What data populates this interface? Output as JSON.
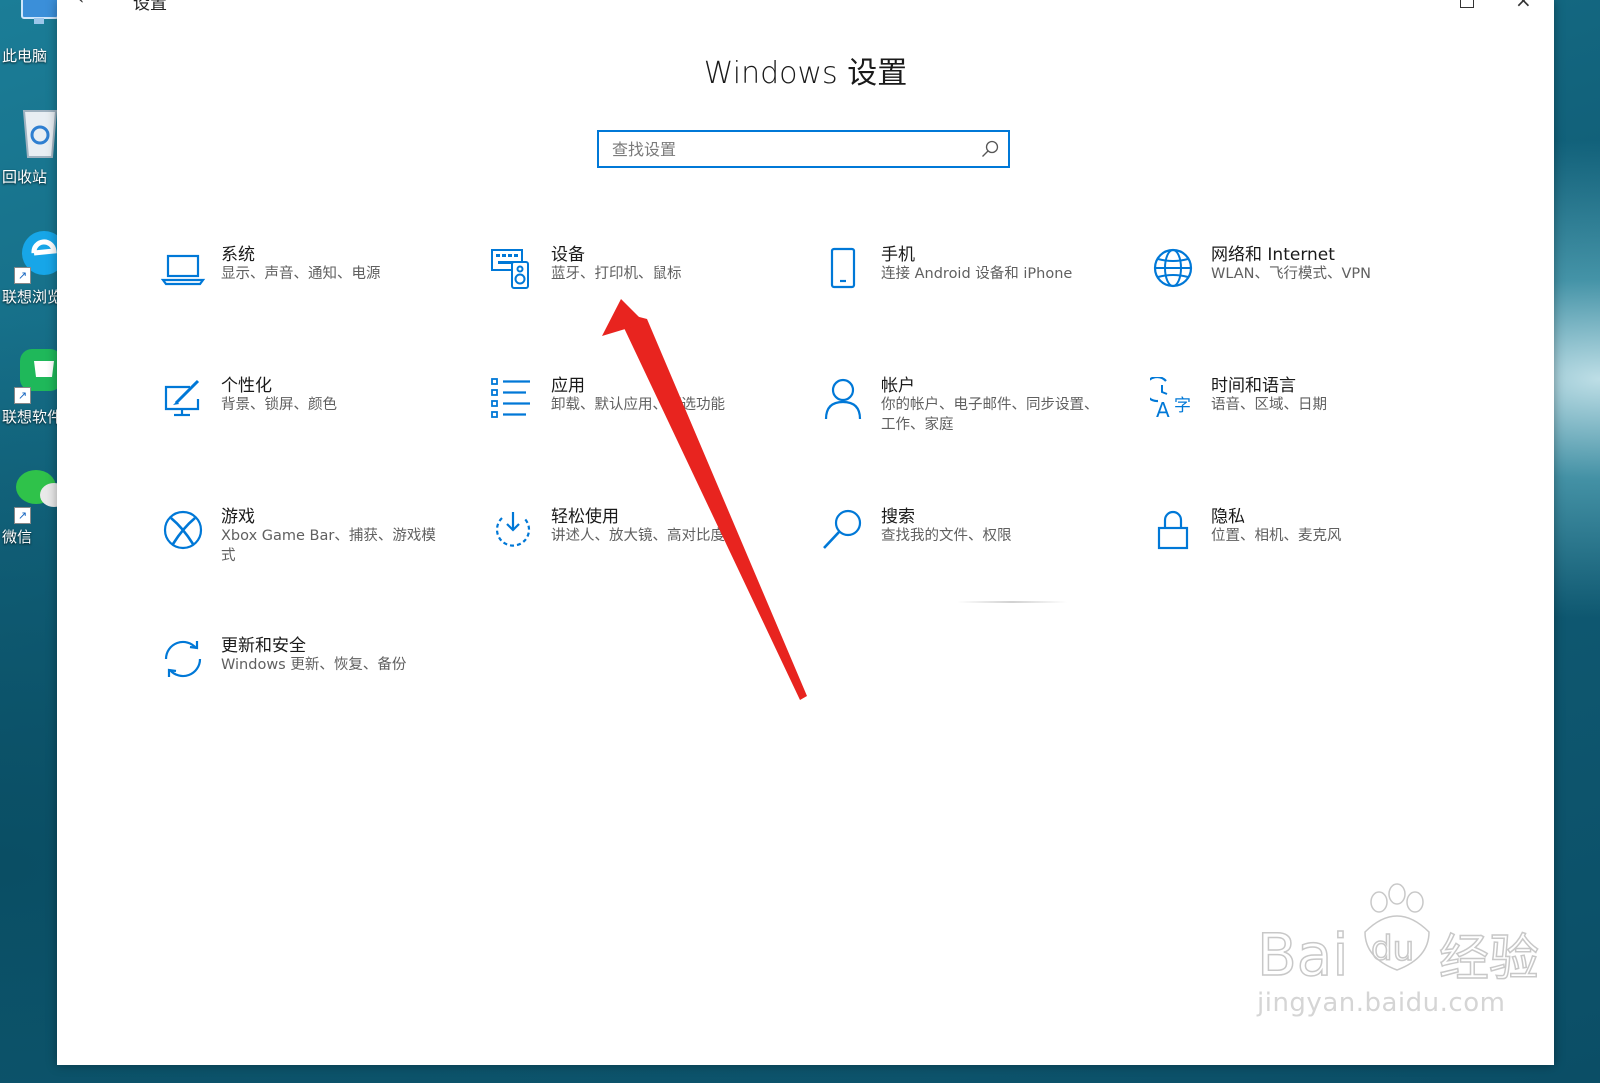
{
  "desktop": {
    "icons": [
      {
        "label": "此电脑"
      },
      {
        "label": "回收站"
      },
      {
        "label": "联想浏览器"
      },
      {
        "label": "联想软件商店"
      },
      {
        "label": "微信"
      }
    ]
  },
  "window": {
    "title": "设置",
    "heading": "Windows 设置",
    "search": {
      "placeholder": "查找设置",
      "value": ""
    },
    "accent_color": "#0078d7",
    "tiles": [
      {
        "name": "系统",
        "desc": "显示、声音、通知、电源",
        "icon": "laptop-icon"
      },
      {
        "name": "设备",
        "desc": "蓝牙、打印机、鼠标",
        "icon": "keyboard-speaker-icon"
      },
      {
        "name": "手机",
        "desc": "连接 Android 设备和 iPhone",
        "icon": "phone-icon"
      },
      {
        "name": "网络和 Internet",
        "desc": "WLAN、飞行模式、VPN",
        "icon": "globe-icon"
      },
      {
        "name": "个性化",
        "desc": "背景、锁屏、颜色",
        "icon": "paint-monitor-icon"
      },
      {
        "name": "应用",
        "desc": "卸载、默认应用、可选功能",
        "icon": "apps-list-icon"
      },
      {
        "name": "帐户",
        "desc": "你的帐户、电子邮件、同步设置、工作、家庭",
        "icon": "person-icon"
      },
      {
        "name": "时间和语言",
        "desc": "语音、区域、日期",
        "icon": "time-language-icon"
      },
      {
        "name": "游戏",
        "desc": "Xbox Game Bar、捕获、游戏模式",
        "icon": "xbox-icon"
      },
      {
        "name": "轻松使用",
        "desc": "讲述人、放大镜、高对比度",
        "icon": "ease-of-access-icon"
      },
      {
        "name": "搜索",
        "desc": "查找我的文件、权限",
        "icon": "magnifier-icon"
      },
      {
        "name": "隐私",
        "desc": "位置、相机、麦克风",
        "icon": "lock-icon"
      },
      {
        "name": "更新和安全",
        "desc": "Windows 更新、恢复、备份",
        "icon": "refresh-sync-icon"
      }
    ]
  },
  "annotation": {
    "color": "#e8241f",
    "target": "设备"
  },
  "watermark": {
    "brand": "Bai du 经验",
    "url": "jingyan.baidu.com"
  }
}
